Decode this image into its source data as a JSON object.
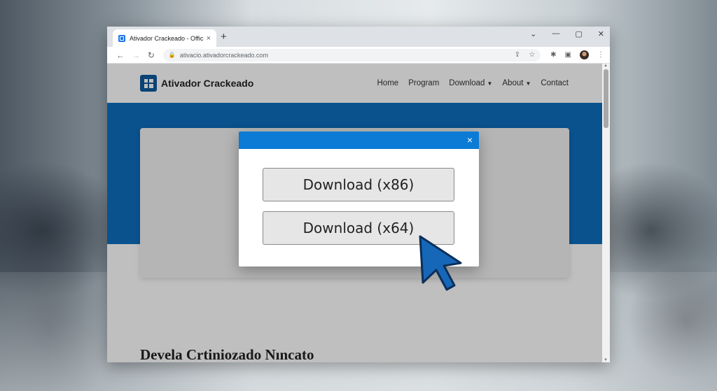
{
  "browser": {
    "tab_title": "Ativador Crackeado - Official",
    "tab_close": "×",
    "new_tab": "+",
    "window_controls": {
      "minimize": "—",
      "restore": "▢",
      "close": "✕",
      "tabsearch": "⌄"
    },
    "url": "ativacio.ativadorcrackeado.com",
    "icons": [
      "back-icon",
      "forward-icon",
      "reload-icon",
      "lock-icon",
      "share-icon",
      "star-icon",
      "extensions-icon",
      "sidepanel-icon",
      "profile-avatar",
      "menu-icon"
    ]
  },
  "site": {
    "brand": "Ativador Crackeado",
    "nav": [
      "Home",
      "Program",
      "Download",
      "About",
      "Contact"
    ],
    "section_heading": "Devela Crtiniozado Nıncato"
  },
  "modal": {
    "close": "×",
    "button_x86": "Download (x86)",
    "button_x64": "Download (x64)"
  },
  "colors": {
    "hero_blue": "#0d6ebe",
    "modal_header": "#0b7bd6",
    "brand_logo": "#0e5a9c",
    "cursor_blue": "#1767b8"
  }
}
